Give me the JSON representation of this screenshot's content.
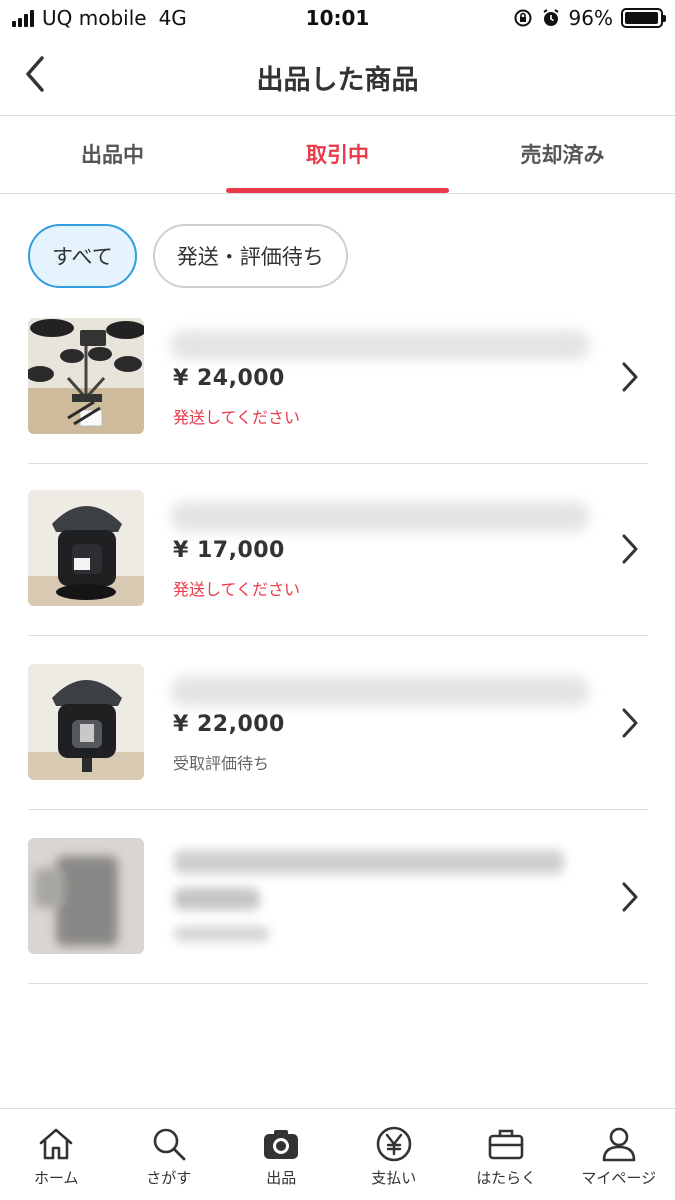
{
  "status_bar": {
    "carrier": "UQ mobile",
    "network": "4G",
    "time": "10:01",
    "battery_percent": "96%",
    "battery_level": 0.96,
    "icons": [
      "signal-icon",
      "orientation-lock-icon",
      "alarm-icon",
      "battery-icon"
    ]
  },
  "header": {
    "title": "出品した商品",
    "back_icon": "chevron-left-icon"
  },
  "tabs": [
    {
      "label": "出品中",
      "active": false
    },
    {
      "label": "取引中",
      "active": true
    },
    {
      "label": "売却済み",
      "active": false
    }
  ],
  "filters": [
    {
      "label": "すべて",
      "active": true
    },
    {
      "label": "発送・評価待ち",
      "active": false
    }
  ],
  "items": [
    {
      "price": "¥ 24,000",
      "status": "発送してください",
      "status_color": "#ea3a4a",
      "thumbnail": "electronic-drum-kit"
    },
    {
      "price": "¥ 17,000",
      "status": "発送してください",
      "status_color": "#ea3a4a",
      "thumbnail": "child-car-seat"
    },
    {
      "price": "¥ 22,000",
      "status": "受取評価待ち",
      "status_color": "#666666",
      "thumbnail": "child-car-seat"
    },
    {
      "price": "",
      "status": "",
      "status_color": "#666666",
      "thumbnail": "blurred-clothing"
    }
  ],
  "bottom_nav": [
    {
      "label": "ホーム",
      "icon": "home-icon"
    },
    {
      "label": "さがす",
      "icon": "search-icon"
    },
    {
      "label": "出品",
      "icon": "camera-icon"
    },
    {
      "label": "支払い",
      "icon": "yen-icon"
    },
    {
      "label": "はたらく",
      "icon": "briefcase-icon"
    },
    {
      "label": "マイページ",
      "icon": "user-icon"
    }
  ],
  "colors": {
    "accent": "#ea3a4a",
    "chip_active_border": "#2f9ee0",
    "chip_active_bg": "#e4f3fc"
  }
}
